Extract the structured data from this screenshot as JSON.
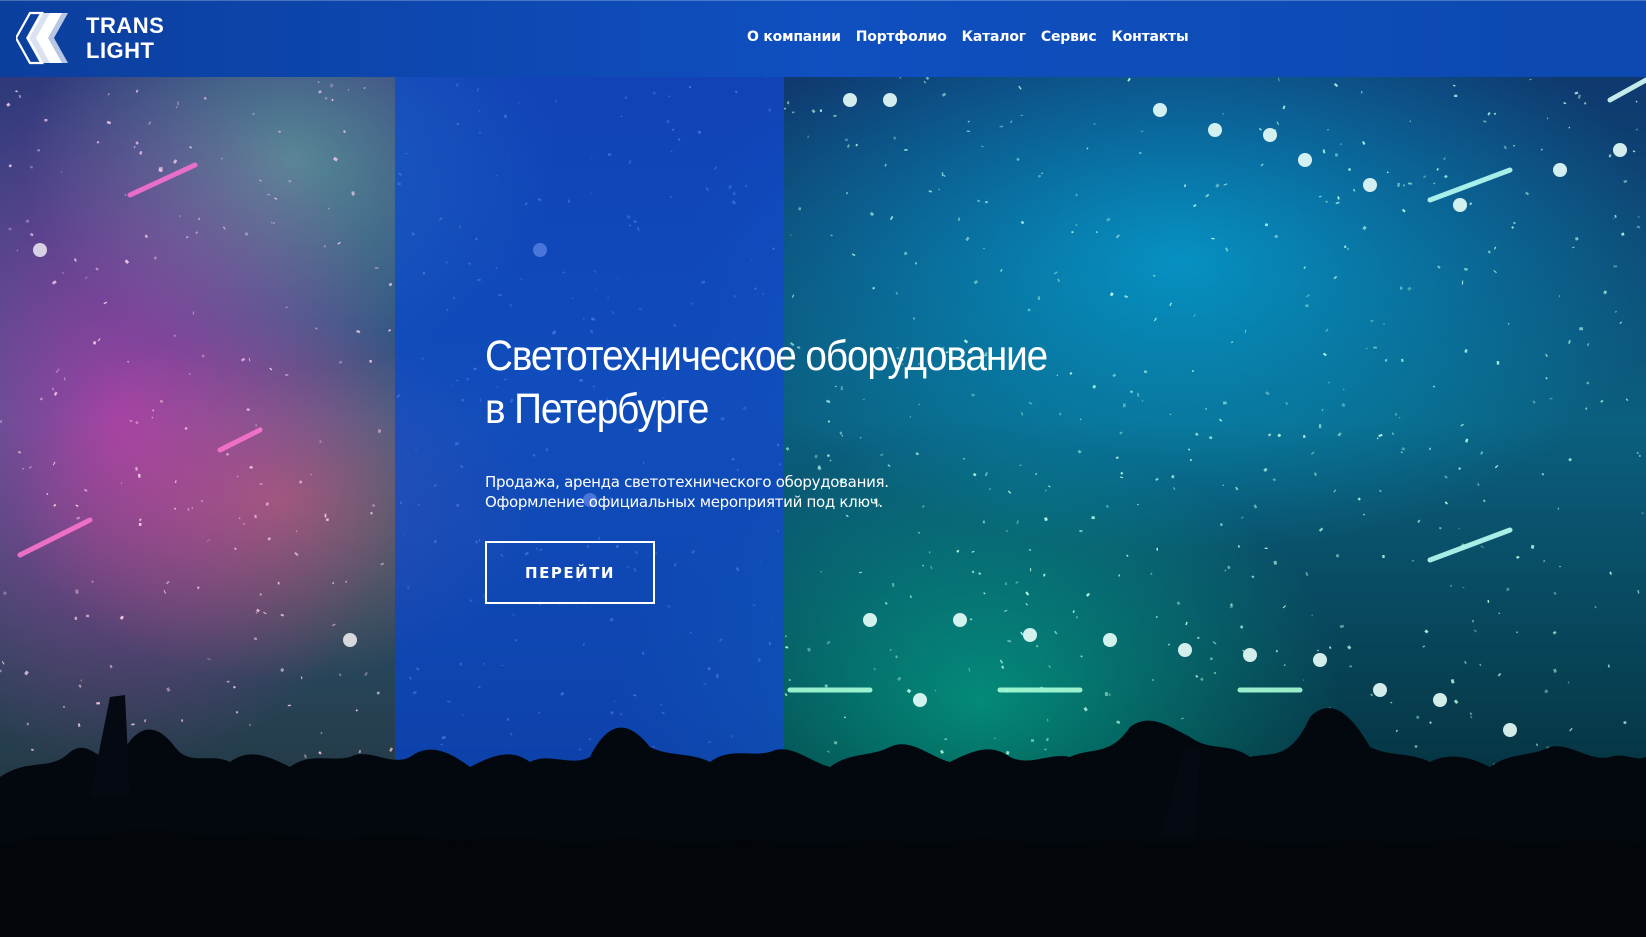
{
  "brand": {
    "name_line1": "TRANS",
    "name_line2": "LIGHT",
    "logo_icon": "diamond-stripes-logo-icon"
  },
  "nav": {
    "items": [
      {
        "label": "О компании"
      },
      {
        "label": "Портфолио"
      },
      {
        "label": "Каталог"
      },
      {
        "label": "Сервис"
      },
      {
        "label": "Контакты"
      }
    ]
  },
  "hero": {
    "title_line1": "Светотехническое оборудование",
    "title_line2": "в Петербурге",
    "subtitle_line1": "Продажа, аренда светотехнического оборудования.",
    "subtitle_line2": "Оформление официальных мероприятий под ключ.",
    "cta_label": "ПЕРЕЙТИ",
    "background": "concert-crowd-confetti-photo"
  },
  "colors": {
    "navbar": "#0f4fbf",
    "band_overlay": "#1246d2",
    "text": "#ffffff"
  }
}
